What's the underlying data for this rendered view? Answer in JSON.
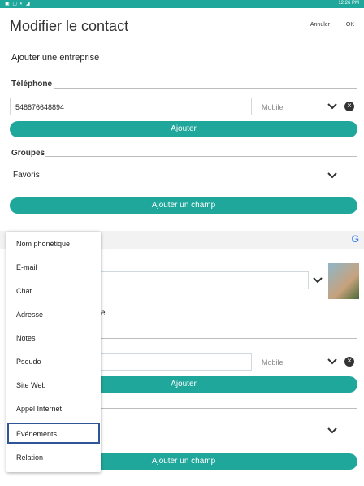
{
  "status_bar": {
    "left_icons": "▣ ▢ ◐ ◢",
    "time": "12:26 PM"
  },
  "header": {
    "title": "Modifier le contact",
    "cancel_label": "Annuler",
    "ok_label": "OK"
  },
  "company_link": "Ajouter une entreprise",
  "phone": {
    "section_label": "Téléphone",
    "number": "548876648894",
    "type": "Mobile",
    "add_label": "Ajouter"
  },
  "groups": {
    "section_label": "Groupes",
    "value": "Favoris"
  },
  "add_field_label": "Ajouter un champ",
  "account": {
    "google_letter": "G"
  },
  "phone2": {
    "type": "Mobile",
    "add_label": "Ajouter"
  },
  "add_field_label_2": "Ajouter un champ",
  "partial_text": "e",
  "menu": {
    "items": [
      "Nom phonétique",
      "E-mail",
      "Chat",
      "Adresse",
      "Notes",
      "Pseudo",
      "Site Web",
      "Appel Internet",
      "Événements",
      "Relation"
    ],
    "selected_index": 8
  },
  "colors": {
    "accent": "#1fa79b",
    "selection_outline": "#2f5597"
  }
}
